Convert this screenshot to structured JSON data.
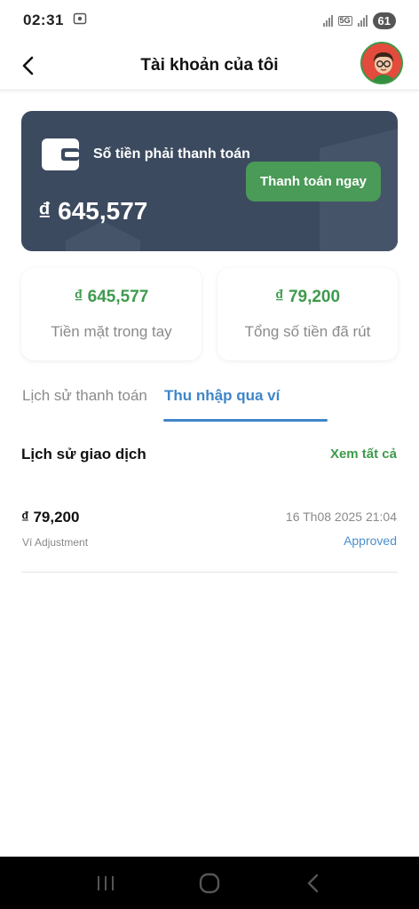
{
  "status_bar": {
    "time": "02:31",
    "network": "5G",
    "battery": "61"
  },
  "header": {
    "title": "Tài khoản của tôi"
  },
  "balance_card": {
    "label": "Số tiền phải thanh toán",
    "amount": "₫ 645,577",
    "pay_button": "Thanh toán ngay"
  },
  "stats": [
    {
      "amount": "₫ 645,577",
      "label": "Tiền mặt trong tay"
    },
    {
      "amount": "₫ 79,200",
      "label": "Tổng số tiền đã rút"
    }
  ],
  "tabs": [
    {
      "label": "Lịch sử thanh toán",
      "active": false
    },
    {
      "label": "Thu nhập qua ví",
      "active": true
    }
  ],
  "transactions_section": {
    "title": "Lịch sử giao dịch",
    "view_all": "Xem tất cả"
  },
  "transactions": [
    {
      "amount": "₫ 79,200",
      "description": "Ví Adjustment",
      "date": "16 Th08 2025 21:04",
      "status": "Approved"
    }
  ],
  "colors": {
    "card_bg": "#3c4a5f",
    "accent_green": "#3f9a4d",
    "button_green": "#4a9a58",
    "accent_blue": "#3f86c9"
  },
  "icons": {
    "back": "chevron-left-icon",
    "wallet": "wallet-icon",
    "nav_recent": "recent-apps-icon",
    "nav_home": "home-icon",
    "nav_back": "back-icon"
  }
}
